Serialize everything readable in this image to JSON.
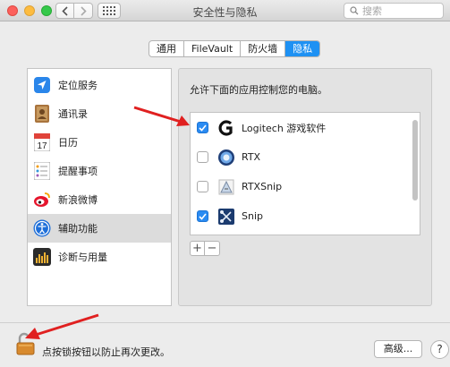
{
  "window": {
    "title": "安全性与隐私"
  },
  "search": {
    "placeholder": "搜索"
  },
  "tabs": [
    {
      "label": "通用",
      "active": false
    },
    {
      "label": "FileVault",
      "active": false
    },
    {
      "label": "防火墙",
      "active": false
    },
    {
      "label": "隐私",
      "active": true
    }
  ],
  "sidebar": {
    "items": [
      {
        "label": "定位服务",
        "icon": "location-icon"
      },
      {
        "label": "通讯录",
        "icon": "contacts-icon"
      },
      {
        "label": "日历",
        "icon": "calendar-icon",
        "icon_text": "17"
      },
      {
        "label": "提醒事项",
        "icon": "reminders-icon"
      },
      {
        "label": "新浪微博",
        "icon": "weibo-icon"
      },
      {
        "label": "辅助功能",
        "icon": "accessibility-icon",
        "selected": true
      },
      {
        "label": "诊断与用量",
        "icon": "diagnostics-icon"
      }
    ]
  },
  "panel": {
    "prompt": "允许下面的应用控制您的电脑。",
    "apps": [
      {
        "name": "Logitech 游戏软件",
        "checked": true,
        "icon": "logitech-icon"
      },
      {
        "name": "RTX",
        "checked": false,
        "icon": "rtx-icon"
      },
      {
        "name": "RTXSnip",
        "checked": false,
        "icon": "rtxsnip-icon"
      },
      {
        "name": "Snip",
        "checked": true,
        "icon": "snip-icon"
      }
    ],
    "add_symbol": "+",
    "remove_symbol": "−"
  },
  "footer": {
    "lock_text": "点按锁按钮以防止再次更改。",
    "advanced_label": "高级...",
    "help_label": "?"
  },
  "colors": {
    "accent": "#1e91f3",
    "checkbox": "#2a8bf2",
    "annotation_arrow": "#e02020"
  }
}
